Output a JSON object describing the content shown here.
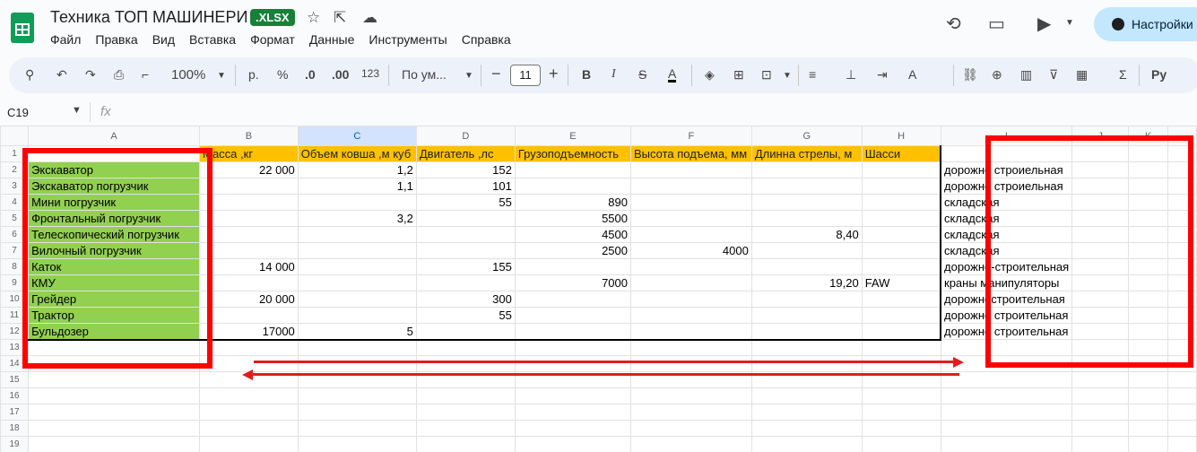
{
  "app": {
    "doc_title": "Техника ТОП МАШИНЕРИ",
    "file_badge": ".XLSX",
    "settings_label": "Настройки"
  },
  "menu": [
    "Файл",
    "Правка",
    "Вид",
    "Вставка",
    "Формат",
    "Данные",
    "Инструменты",
    "Справка"
  ],
  "toolbar": {
    "zoom": "100%",
    "currency": "р.",
    "percent": "%",
    "dec_decrease": ".0",
    "dec_increase": ".00",
    "number_format": "123",
    "font_name": "По ум...",
    "font_size": "11"
  },
  "formula_bar": {
    "cell_ref": "C19",
    "fx": "fx"
  },
  "colors": {
    "header_fill": "#ffc000",
    "name_fill": "#92d050",
    "annotation_red": "#ff0000",
    "selected_column": "#d3e3fd"
  },
  "sheet": {
    "columns": [
      "A",
      "B",
      "C",
      "D",
      "E",
      "F",
      "G",
      "H",
      "I",
      "J",
      "K"
    ],
    "selected_column": "C",
    "header_row": [
      "",
      "Масса ,кг",
      "Объем ковша ,м куб",
      "Двигатель ,лс",
      "Грузоподъемность",
      "Высота подъема, мм",
      "Длинна стрелы, м",
      "Шасси",
      "",
      "",
      ""
    ],
    "rows": [
      [
        "Экскаватор",
        "22 000",
        "1,2",
        "152",
        "",
        "",
        "",
        "",
        "дорожно строиельная"
      ],
      [
        "Экскаватор погрузчик",
        "",
        "1,1",
        "101",
        "",
        "",
        "",
        "",
        "дорожно строиельная"
      ],
      [
        "Мини погрузчик",
        "",
        "",
        "55",
        "890",
        "",
        "",
        "",
        "складская"
      ],
      [
        "Фронтальный погрузчик",
        "",
        "3,2",
        "",
        "5500",
        "",
        "",
        "",
        "складская"
      ],
      [
        "Телескопический погрузчик",
        "",
        "",
        "",
        "4500",
        "",
        "8,40",
        "",
        "складская"
      ],
      [
        "Вилочный погрузчик",
        "",
        "",
        "",
        "2500",
        "4000",
        "",
        "",
        "складская"
      ],
      [
        "Каток",
        "14 000",
        "",
        "155",
        "",
        "",
        "",
        "",
        "дорожно-строительная"
      ],
      [
        "КМУ",
        "",
        "",
        "",
        "7000",
        "",
        "19,20",
        "FAW",
        "краны манипуляторы"
      ],
      [
        "Грейдер",
        "20 000",
        "",
        "300",
        "",
        "",
        "",
        "",
        "дорожностроительная"
      ],
      [
        "Трактор",
        "",
        "",
        "55",
        "",
        "",
        "",
        "",
        "дорожно строительная"
      ],
      [
        "Бульдозер",
        "17000",
        "5",
        "",
        "",
        "",
        "",
        "",
        "дорожно строительная"
      ]
    ]
  }
}
